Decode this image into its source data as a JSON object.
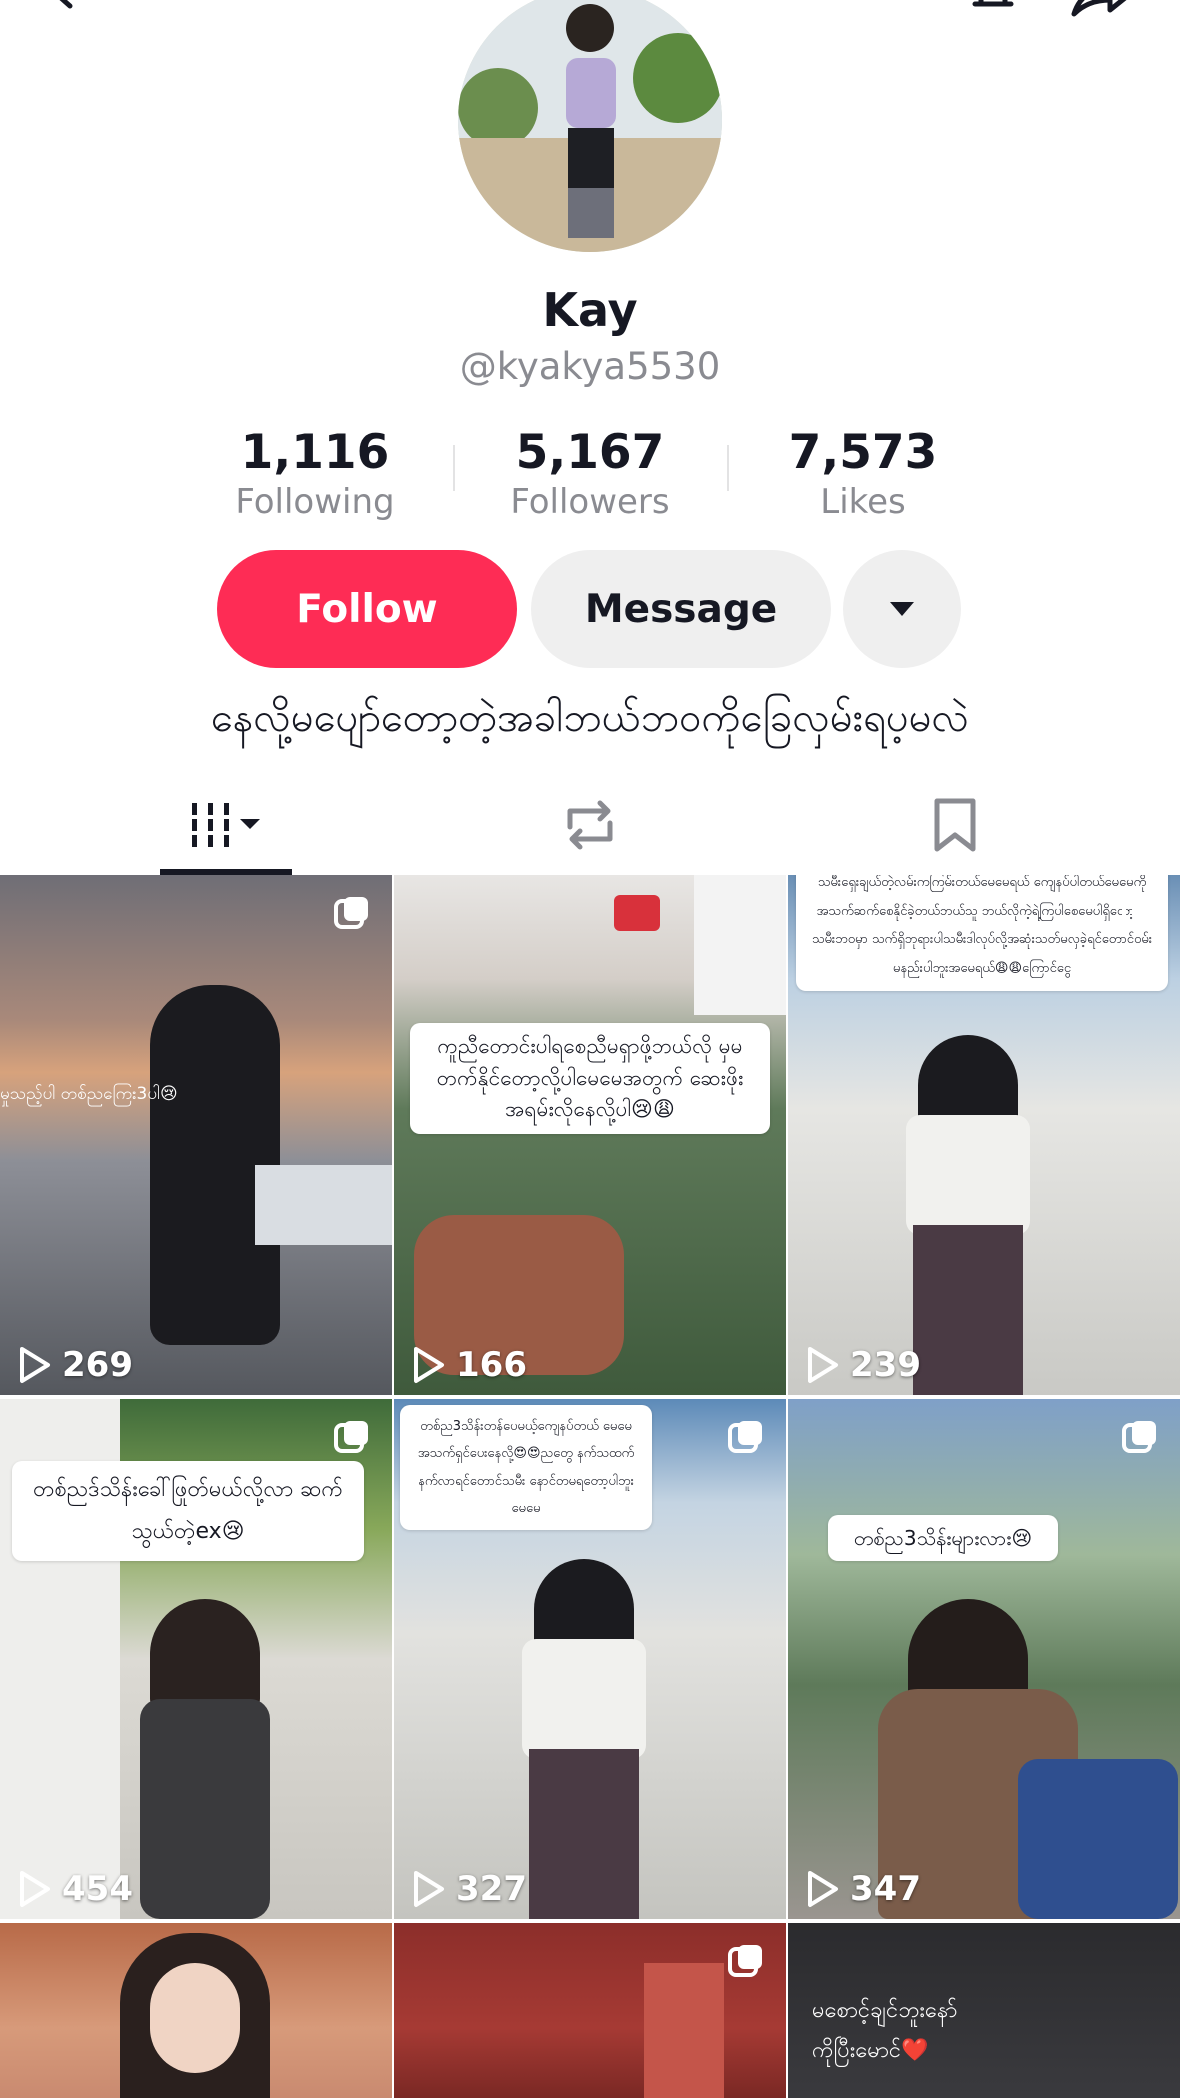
{
  "profile": {
    "display_name": "Kay",
    "handle": "@kyakya5530",
    "bio": "နေလို့မပျော်တော့တဲ့အခါဘယ်ဘဝကိုခြေလှမ်းရပ့မလဲ"
  },
  "stats": [
    {
      "value": "1,116",
      "label": "Following"
    },
    {
      "value": "5,167",
      "label": "Followers"
    },
    {
      "value": "7,573",
      "label": "Likes"
    }
  ],
  "actions": {
    "follow_label": "Follow",
    "message_label": "Message"
  },
  "tabs": [
    {
      "icon": "videos-grid-icon",
      "active": true
    },
    {
      "icon": "repost-icon",
      "active": false
    },
    {
      "icon": "bookmark-icon",
      "active": false
    }
  ],
  "videos": [
    {
      "views": "269",
      "caption": "မှုသည့်ပါ တစ်ညကြေး3ပါ😢",
      "multi": true
    },
    {
      "views": "166",
      "caption": "ကူညီတောင်းပါရစေညီမရှာဖို့ဘယ်လို မှမတက်နိုင်တော့လို့ပါမေမေအတွက် ဆေးဖိုးအရမ်းလိုနေလို့ပါ😢😩",
      "multi": false
    },
    {
      "views": "239",
      "caption": "သမီးရှေးချယ်တဲ့လမ်းကကြမ်းတယ်မေမေရယ် ကျေနပ်ပါတယ်မေမေကိုအသက်ဆက်စေနိုင်ခဲ့တယ်ဘယ်သူ ဘယ်လိုကဲ့ရဲ့ကြပါစေမေပါရှိတော့တဲ့သမီးဘဝမှာ သက်ရှိဘုရားပါသမီးဒါလုပ်လို့အဆုံးသတ်မလှခဲ့ရင်တောင်ဝမ်း မနည်းပါဘူးအမေရယ်😩😩ကြောင်ငွေ",
      "multi": true
    },
    {
      "views": "454",
      "caption": "တစ်ညဒ်သိန်းခေါ်ဖြုတ်မယ်လို့လာ ဆက်သွယ်တဲ့ex😢",
      "multi": true
    },
    {
      "views": "327",
      "caption": "တစ်ည3သိန်းတန်ပေမယ့်ကျေနပ်တယ် မေမေအသက်ရှင်ပေးနေလို့😍😍ညတွေ နက်သထက်နက်လာရင်တောင်သမီး နောင်တမရတော့ပါဘူးမေမေ",
      "multi": true
    },
    {
      "views": "347",
      "caption": "တစ်ည3သိန်းများလား😢",
      "multi": true
    },
    {
      "views": "",
      "caption": "",
      "multi": false
    },
    {
      "views": "",
      "caption": "",
      "multi": true
    },
    {
      "views": "",
      "caption": "မစောင့်ချင်ဘူးနော် ကိုပြီးမောင်❤️",
      "multi": false
    }
  ],
  "colors": {
    "accent": "#fe2c55",
    "secondary_button": "#efefef",
    "muted_text": "#8a8b91"
  }
}
